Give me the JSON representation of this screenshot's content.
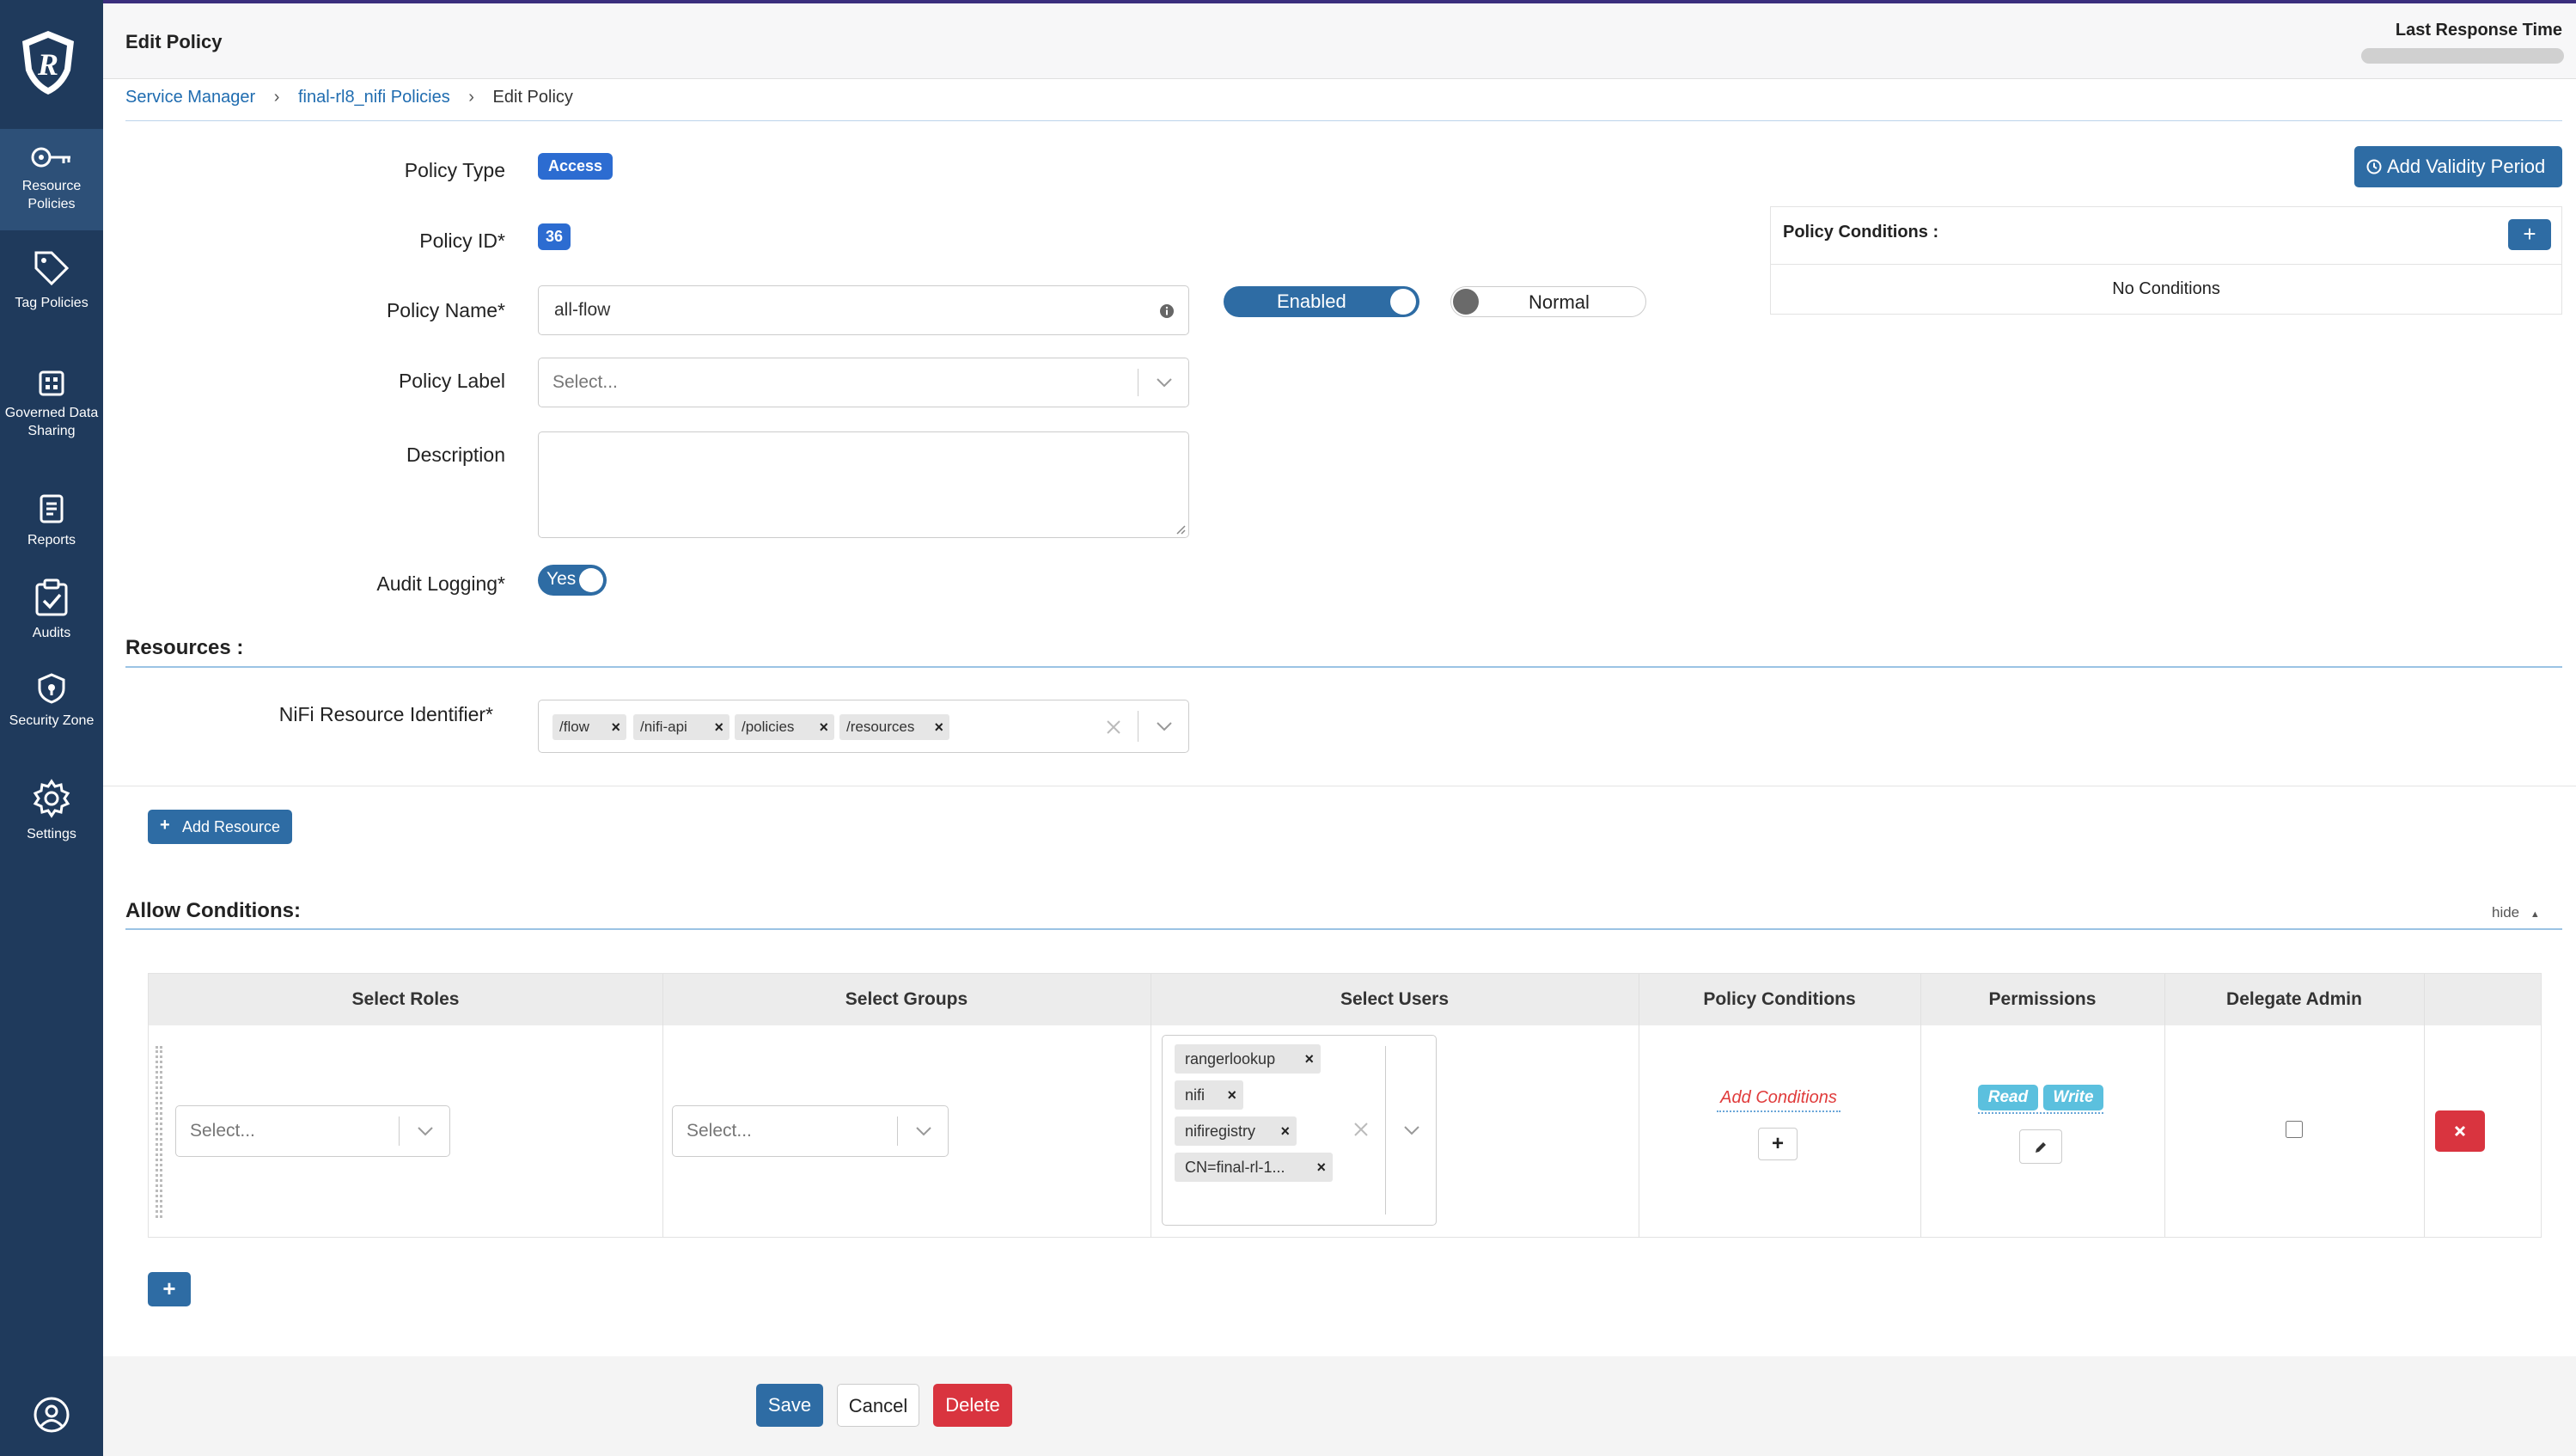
{
  "sidebar": {
    "items": [
      {
        "label": "Resource Policies",
        "icon": "key-icon"
      },
      {
        "label": "Tag Policies",
        "icon": "tag-icon"
      },
      {
        "label": "Governed Data Sharing",
        "icon": "grid-icon"
      },
      {
        "label": "Reports",
        "icon": "report-icon"
      },
      {
        "label": "Audits",
        "icon": "clipboard-check-icon"
      },
      {
        "label": "Security Zone",
        "icon": "shield-lock-icon"
      },
      {
        "label": "Settings",
        "icon": "gear-icon"
      }
    ],
    "user_icon": "user-circle-icon"
  },
  "header": {
    "title": "Edit Policy",
    "last_response_label": "Last Response Time"
  },
  "breadcrumb": {
    "items": [
      "Service Manager",
      "final-rl8_nifi Policies",
      "Edit Policy"
    ]
  },
  "form": {
    "policy_type_label": "Policy Type",
    "policy_type_value": "Access",
    "policy_id_label": "Policy ID*",
    "policy_id_value": "36",
    "policy_name_label": "Policy Name*",
    "policy_name_value": "all-flow",
    "enabled_label": "Enabled",
    "normal_label": "Normal",
    "policy_label_label": "Policy Label",
    "policy_label_placeholder": "Select...",
    "description_label": "Description",
    "description_value": "",
    "audit_logging_label": "Audit Logging*",
    "audit_logging_value": "Yes"
  },
  "validity": {
    "button_label": "Add Validity Period"
  },
  "policy_conditions": {
    "title": "Policy Conditions :",
    "add_label": "+",
    "empty_text": "No Conditions"
  },
  "resources": {
    "title": "Resources :",
    "identifier_label": "NiFi Resource Identifier*",
    "values": [
      "/flow",
      "/nifi-api",
      "/policies",
      "/resources"
    ],
    "add_resource_label": "Add Resource"
  },
  "allow": {
    "title": "Allow Conditions:",
    "hide_label": "hide",
    "columns": [
      "Select Roles",
      "Select Groups",
      "Select Users",
      "Policy Conditions",
      "Permissions",
      "Delegate Admin"
    ],
    "row": {
      "roles_placeholder": "Select...",
      "groups_placeholder": "Select...",
      "users": [
        "rangerlookup",
        "nifi",
        "nifiregistry",
        "CN=final-rl-1..."
      ],
      "add_conditions_label": "Add Conditions",
      "permissions": [
        "Read",
        "Write"
      ],
      "delegate_admin": false
    },
    "add_row_label": "+"
  },
  "footer": {
    "save": "Save",
    "cancel": "Cancel",
    "delete": "Delete"
  },
  "colors": {
    "sidebar": "#1f3a5c",
    "primary": "#2e6ca4",
    "danger": "#d9343f",
    "badge": "#2c6cd1",
    "info": "#5bc0de"
  }
}
